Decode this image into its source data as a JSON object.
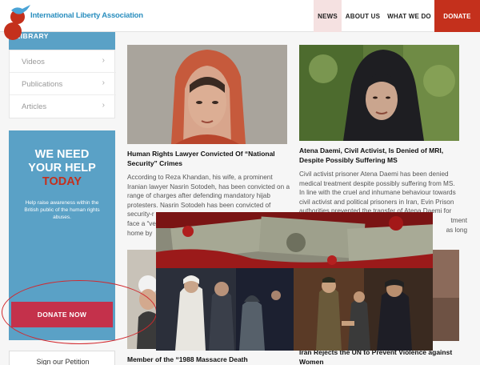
{
  "header": {
    "logo_text": "International Liberty Association",
    "nav": [
      {
        "label": "NEWS"
      },
      {
        "label": "ABOUT US"
      },
      {
        "label": "WHAT WE DO"
      },
      {
        "label": "DONATE"
      }
    ]
  },
  "sidebar": {
    "library_label": "LIBRARY",
    "menu": [
      {
        "label": "Videos"
      },
      {
        "label": "Publications"
      },
      {
        "label": "Articles"
      }
    ],
    "help": {
      "line1": "WE NEED",
      "line2": "YOUR HELP",
      "line3": "TODAY",
      "text": "Help raise awareness within the British public of the human rights abuses.",
      "button": "DONATE NOW"
    },
    "petition_label": "Sign our Petition"
  },
  "articles": [
    {
      "title": "Human Rights Lawyer Convicted Of “National Security” Crimes",
      "lines": [
        "According to Reza Khandan, his wife, a prominent",
        "Iranian lawyer Nasrin Sotodeh, has been convicted on a",
        "range of charges after defending mandatory hijab",
        "protesters. Nasrin Sotodeh has been convicted of",
        "security-r",
        "face a “ve",
        "home by"
      ]
    },
    {
      "title": "Atena Daemi, Civil Activist, Is Denied of MRI, Despite Possibly Suffering MS",
      "lines": [
        "Civil activist prisoner Atena Daemi has been denied",
        "medical treatment despite possibly suffering from MS.",
        "In line with the cruel and inhumane behaviour towards",
        "civil activist and political prisoners in Iran, Evin Prison",
        "authorities prevented the transfer of Atena Daemi for",
        "tment",
        "as long"
      ]
    },
    {
      "title": "Member of the “1988 Massacre Death"
    },
    {
      "title_line1": "Iran Rejects the UN to Prevent Violence against",
      "title_line2": "Women"
    }
  ],
  "colors": {
    "accent_red": "#c4301c",
    "donate_button": "#c4314b",
    "sidebar_blue": "#5aa1c6",
    "logo_blue": "#2b8fbf"
  }
}
